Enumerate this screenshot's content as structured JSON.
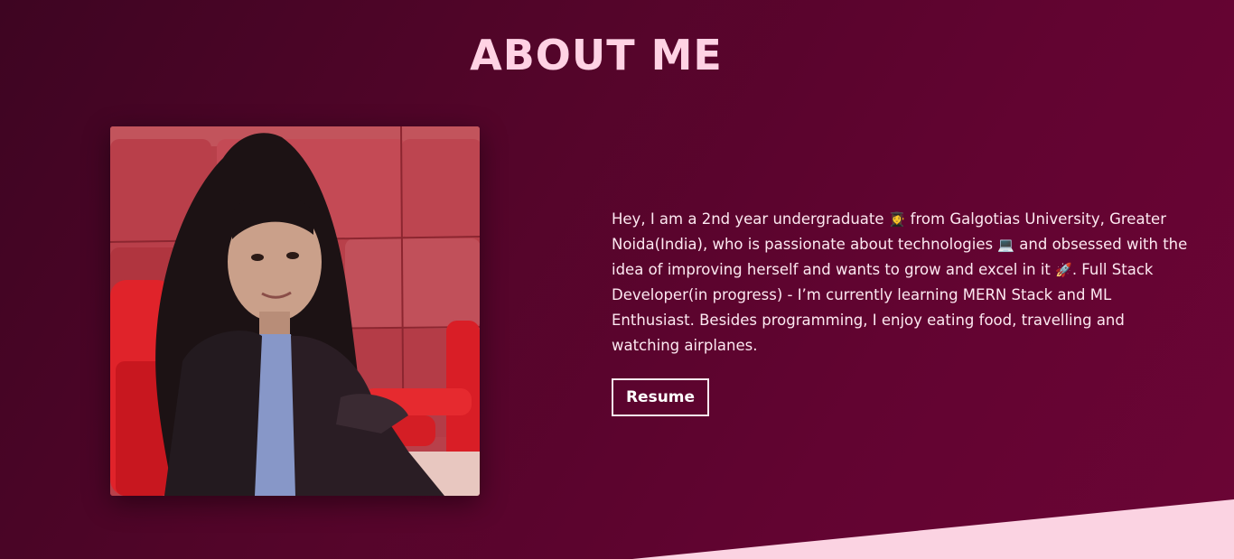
{
  "section": {
    "title": "ABOUT ME"
  },
  "about": {
    "bio_part1": "Hey, I am a 2nd year undergraduate ",
    "emoji_student": "👩‍🎓",
    "bio_part2": " from Galgotias University, Greater Noida(India), who is passionate about technologies ",
    "emoji_laptop": "💻",
    "bio_part3": " and obsessed with the idea of improving herself and wants to grow and excel in it ",
    "emoji_rocket": "🚀",
    "bio_part4": ". Full Stack Developer(in progress) - I’m currently learning MERN Stack and ML Enthusiast. Besides programming, I enjoy eating food, travelling and watching airplanes.",
    "resume_label": "Resume"
  },
  "colors": {
    "background_start": "#3e0522",
    "background_end": "#6b0535",
    "title": "#ffd2e4",
    "wedge": "#fbd3e2"
  }
}
